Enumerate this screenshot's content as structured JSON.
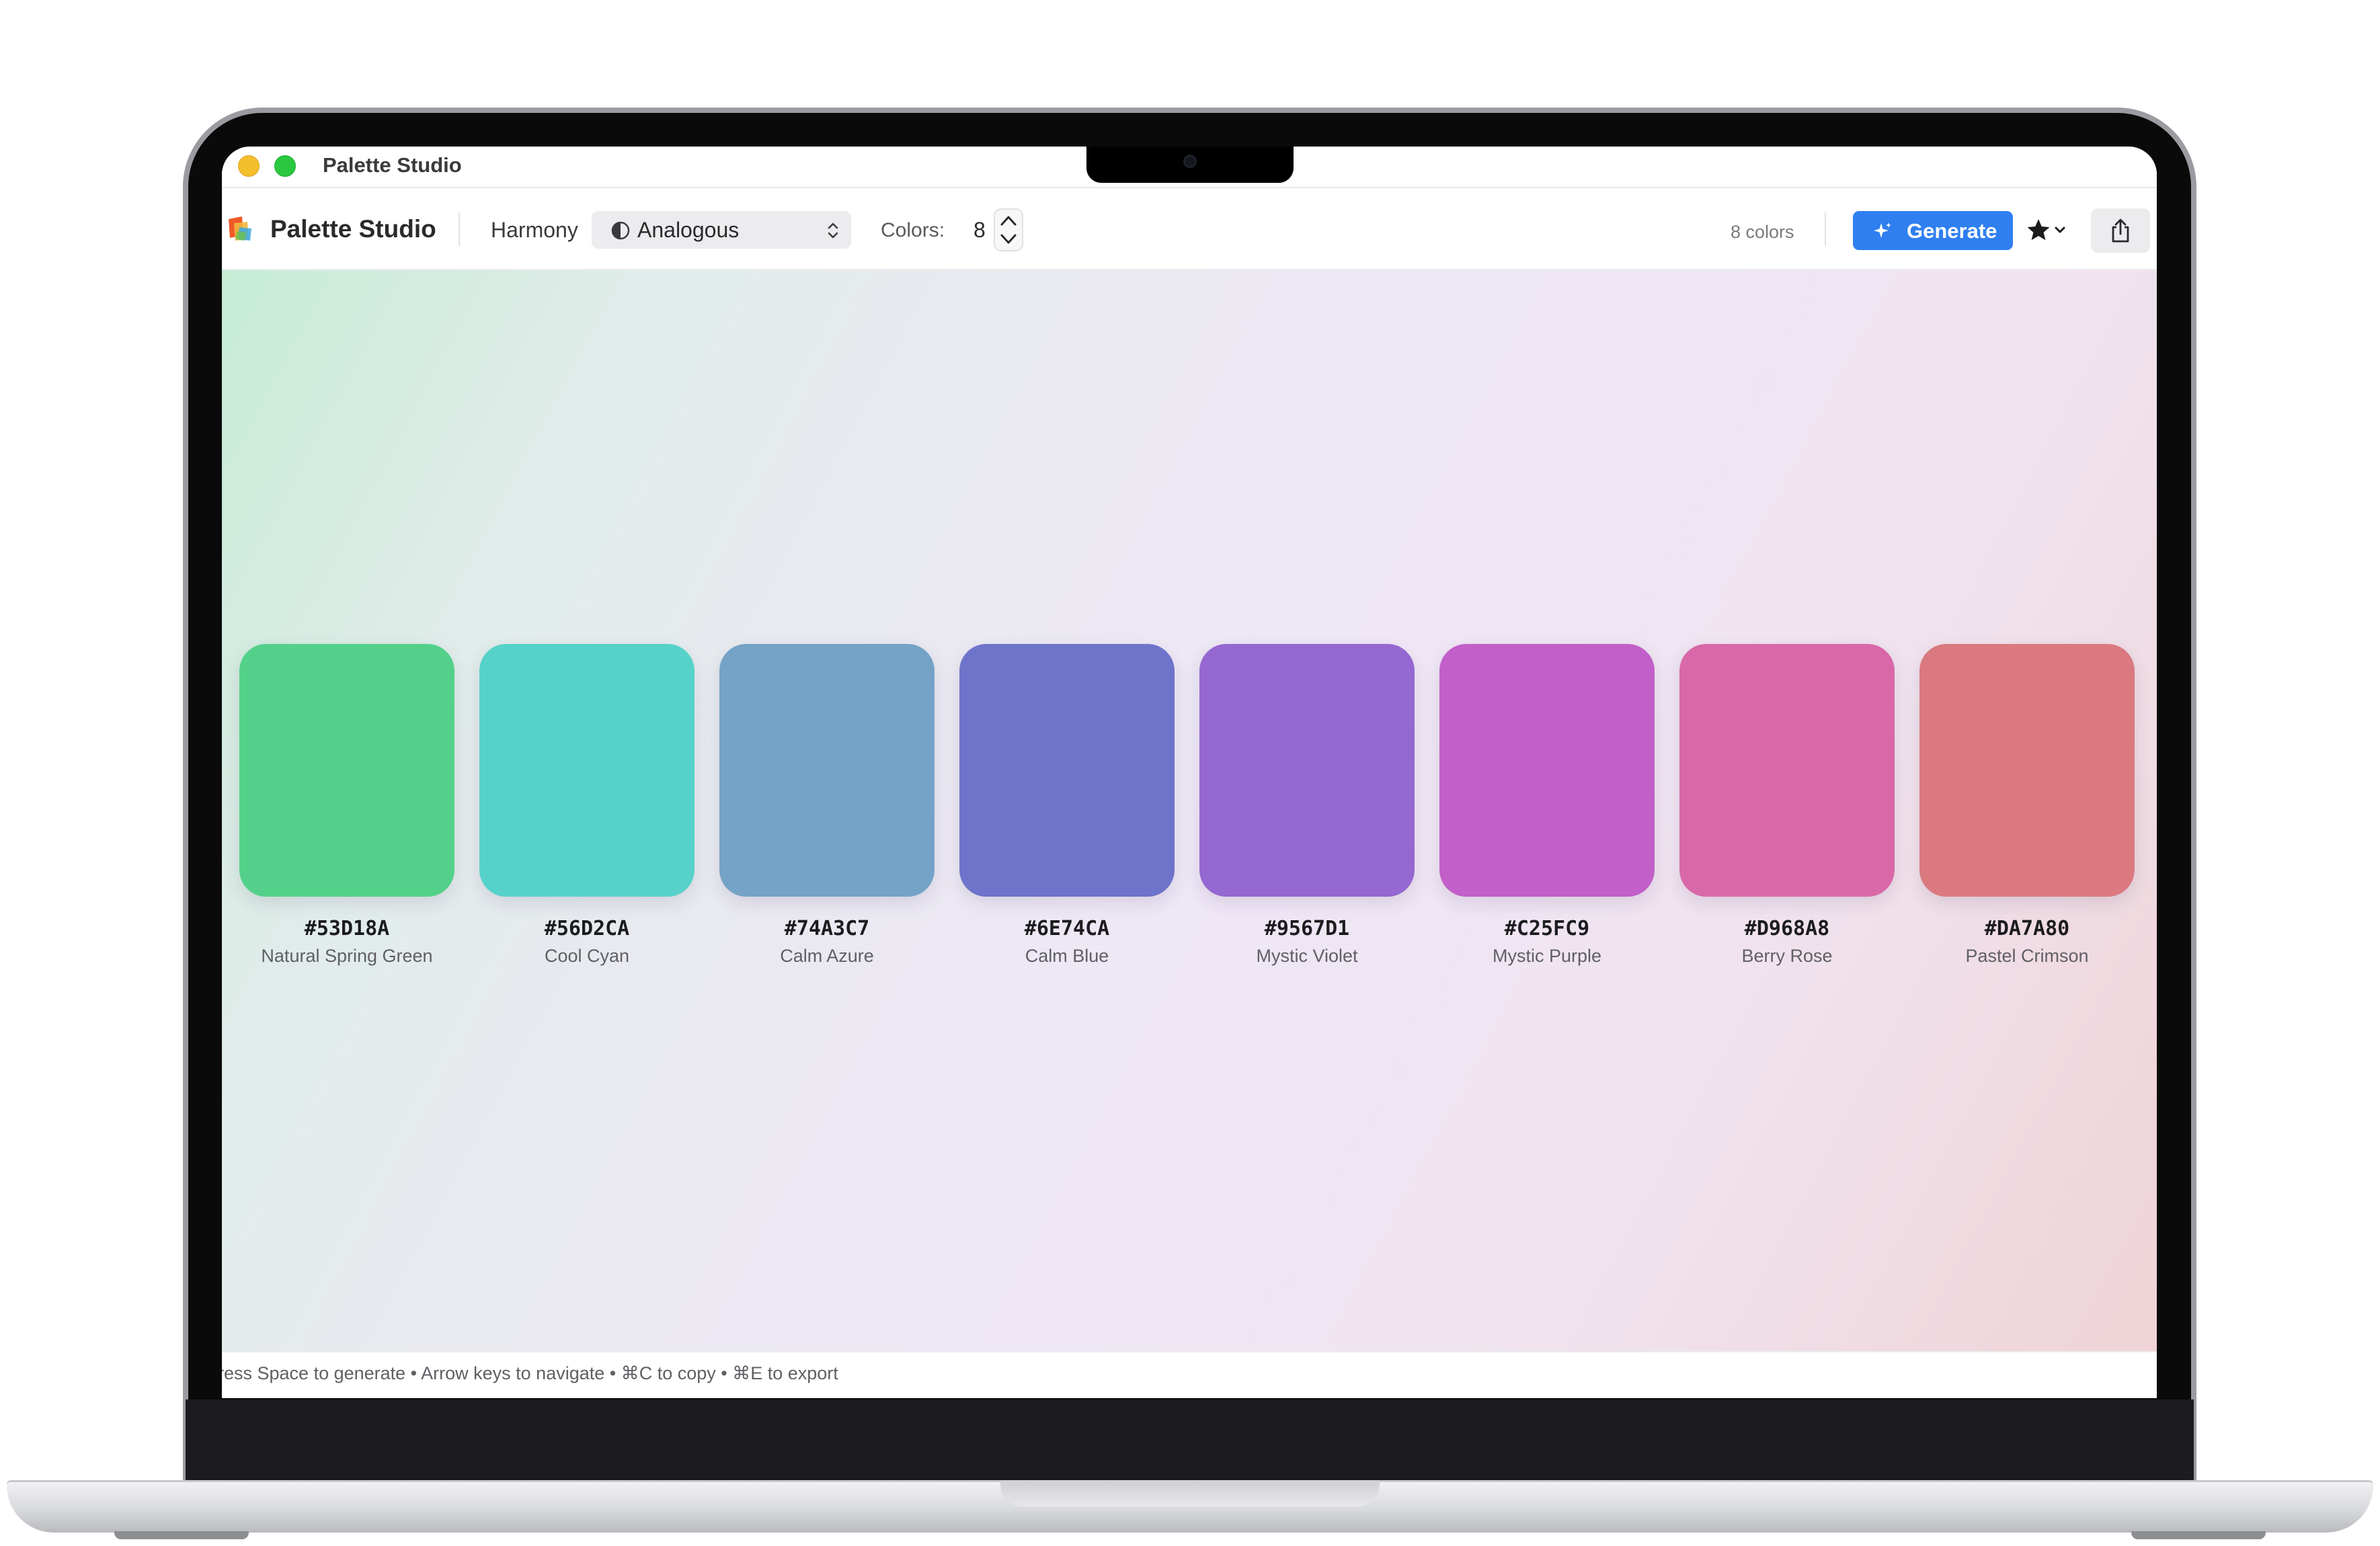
{
  "window": {
    "title": "Palette Studio"
  },
  "toolbar": {
    "app_name": "Palette Studio",
    "harmony_label": "Harmony",
    "harmony_value": "Analogous",
    "colors_label": "Colors:",
    "colors_value": "8",
    "count_text": "8 colors",
    "generate_label": "Generate",
    "accent_color": "#2F7FF0"
  },
  "icons": {
    "app_logo": "palette-logo-icon",
    "harmony": "half-circle-icon",
    "select_chevron": "updown-chevron-icon",
    "stepper": "stepper-arrows-icon",
    "generate": "sparkle-icon",
    "favorites": "star-icon",
    "favorites_menu": "chevron-down-icon",
    "share": "share-icon"
  },
  "palette": [
    {
      "hex": "#53D18A",
      "name": "Natural Spring Green"
    },
    {
      "hex": "#56D2CA",
      "name": "Cool Cyan"
    },
    {
      "hex": "#74A3C7",
      "name": "Calm Azure"
    },
    {
      "hex": "#6E74CA",
      "name": "Calm Blue"
    },
    {
      "hex": "#9567D1",
      "name": "Mystic Violet"
    },
    {
      "hex": "#C25FC9",
      "name": "Mystic Purple"
    },
    {
      "hex": "#D968A8",
      "name": "Berry Rose"
    },
    {
      "hex": "#DA7A80",
      "name": "Pastel Crimson"
    }
  ],
  "statusbar": {
    "hint": "ress Space to generate • Arrow keys to navigate • ⌘C to copy • ⌘E to export"
  }
}
